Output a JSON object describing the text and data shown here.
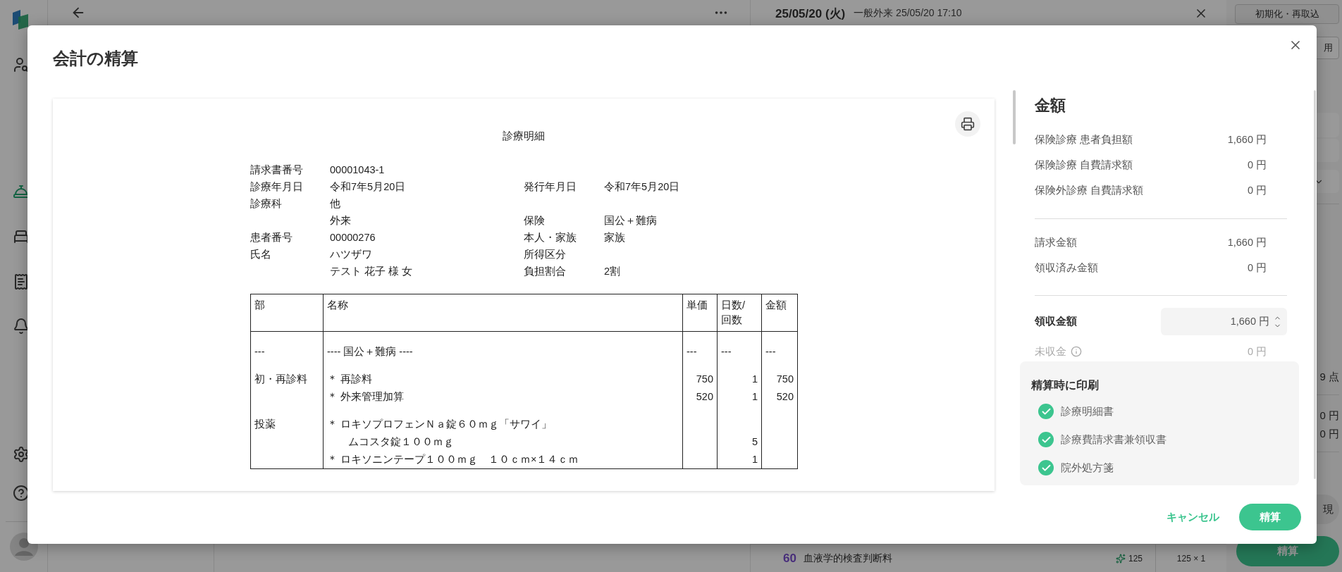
{
  "background": {
    "sidebar": {
      "items": [
        {
          "selected": false
        },
        {
          "selected": true
        },
        {
          "selected": false
        },
        {
          "selected": false
        },
        {
          "selected": false
        }
      ],
      "footer_items": [
        {
          "selected": false
        },
        {
          "selected": false
        }
      ]
    },
    "header": {
      "date": "25/05/20 (火)",
      "visit": "一般外来 25/05/20 17:10"
    },
    "reset_button": "初期化・再取込",
    "side": {
      "button_fragment": "用",
      "points_fragment": "9 点",
      "amounts": [
        "0 円",
        "0 円"
      ],
      "pill_fragment": "現",
      "settle_button": "精算"
    },
    "bottom_item": {
      "points": "60",
      "name": "血液学的検査判断料",
      "score": "125",
      "quantity": "125 × 1"
    }
  },
  "modal": {
    "title": "会計の精算",
    "document": {
      "title": "診療明細",
      "info": [
        {
          "label": "請求書番号",
          "value": "00001043-1"
        },
        {
          "label": "診療年月日",
          "value": "令和7年5月20日",
          "label_2": "発行年月日",
          "value_2": "令和7年5月20日"
        },
        {
          "label": "診療科",
          "value": "他"
        },
        {
          "value": "外来",
          "label_2": "保険",
          "value_2": "国公＋難病"
        },
        {
          "label": "患者番号",
          "value": "00000276",
          "label_2": "本人・家族",
          "value_2": "家族"
        },
        {
          "label": "氏名",
          "value": "ハツザワ",
          "label_2": "所得区分"
        },
        {
          "value": "テスト 花子 様 女",
          "label_2": "負担割合",
          "value_2": "2割"
        }
      ],
      "table": {
        "columns": [
          "部",
          "名称",
          "単価",
          "日数/\n回数",
          "金額"
        ],
        "groups": [
          {
            "lines": [
              {
                "dept": "---",
                "name": "---- 国公＋難病 ----",
                "price": "---",
                "count": "---",
                "amount": "---"
              }
            ]
          },
          {
            "lines": [
              {
                "dept": "初・再診料",
                "name": "＊ 再診料",
                "price": "750",
                "count": "1",
                "amount": "750"
              },
              {
                "name": "＊ 外来管理加算",
                "price": "520",
                "count": "1",
                "amount": "520"
              }
            ]
          },
          {
            "lines": [
              {
                "dept": "投薬",
                "name": "＊ ロキソプロフェンＮａ錠６０ｍｇ「サワイ」"
              },
              {
                "name": "ムコスタ錠１００ｍｇ",
                "indented": true,
                "count": "5"
              },
              {
                "name": "＊ ロキソニンテープ１００ｍｇ　１０ｃｍ×１４ｃｍ",
                "count": "1"
              }
            ]
          }
        ]
      }
    },
    "amounts": {
      "title": "金額",
      "groups": [
        [
          {
            "label": "保険診療 患者負担額",
            "value": "1,660 円"
          },
          {
            "label": "保険診療 自費請求額",
            "value": "0 円"
          },
          {
            "label": "保険外診療 自費請求額",
            "value": "0 円"
          }
        ],
        [
          {
            "label": "請求金額",
            "value": "1,660 円"
          },
          {
            "label": "領収済み金額",
            "value": "0 円"
          }
        ]
      ],
      "receipt": {
        "label": "領収金額",
        "value": "1,660 円"
      },
      "outstanding": {
        "label": "未収金",
        "value": "0 円"
      }
    },
    "print": {
      "title": "精算時に印刷",
      "items": [
        {
          "label": "診療明細書",
          "checked": true
        },
        {
          "label": "診療費請求書兼領収書",
          "checked": true
        },
        {
          "label": "院外処方箋",
          "checked": true
        }
      ]
    },
    "buttons": {
      "cancel": "キャンセル",
      "submit": "精算"
    }
  }
}
